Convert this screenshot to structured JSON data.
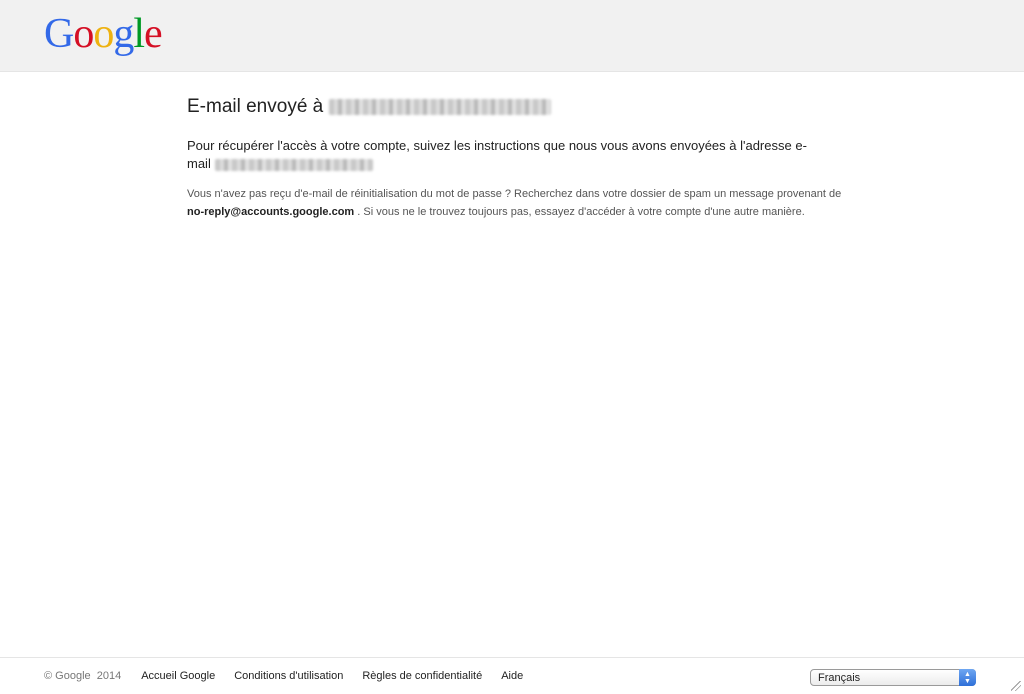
{
  "header": {
    "logo": {
      "letters": [
        "G",
        "o",
        "o",
        "g",
        "l",
        "e"
      ],
      "colors": [
        "#3369e8",
        "#d50f25",
        "#eeb211",
        "#3369e8",
        "#009925",
        "#d50f25"
      ]
    }
  },
  "main": {
    "title_prefix": "E-mail envoyé à",
    "instructions_text": "Pour récupérer l'accès à votre compte, suivez les instructions que nous vous avons envoyées à l'adresse e-mail",
    "note_part1": "Vous n'avez pas reçu d'e-mail de réinitialisation du mot de passe ? Recherchez dans votre dossier de spam un message provenant de",
    "note_email": "no-reply@accounts.google.com",
    "note_part2": ". Si vous ne le trouvez toujours pas, essayez d'accéder à votre compte d'une autre manière."
  },
  "footer": {
    "copyright": "© Google  2014",
    "links": [
      "Accueil Google",
      "Conditions d'utilisation",
      "Règles de confidentialité",
      "Aide"
    ],
    "language_selected": "Français"
  },
  "colors": {
    "header_bg": "#f1f1f1",
    "text": "#222222",
    "select_accent": "#2e6fd8"
  }
}
